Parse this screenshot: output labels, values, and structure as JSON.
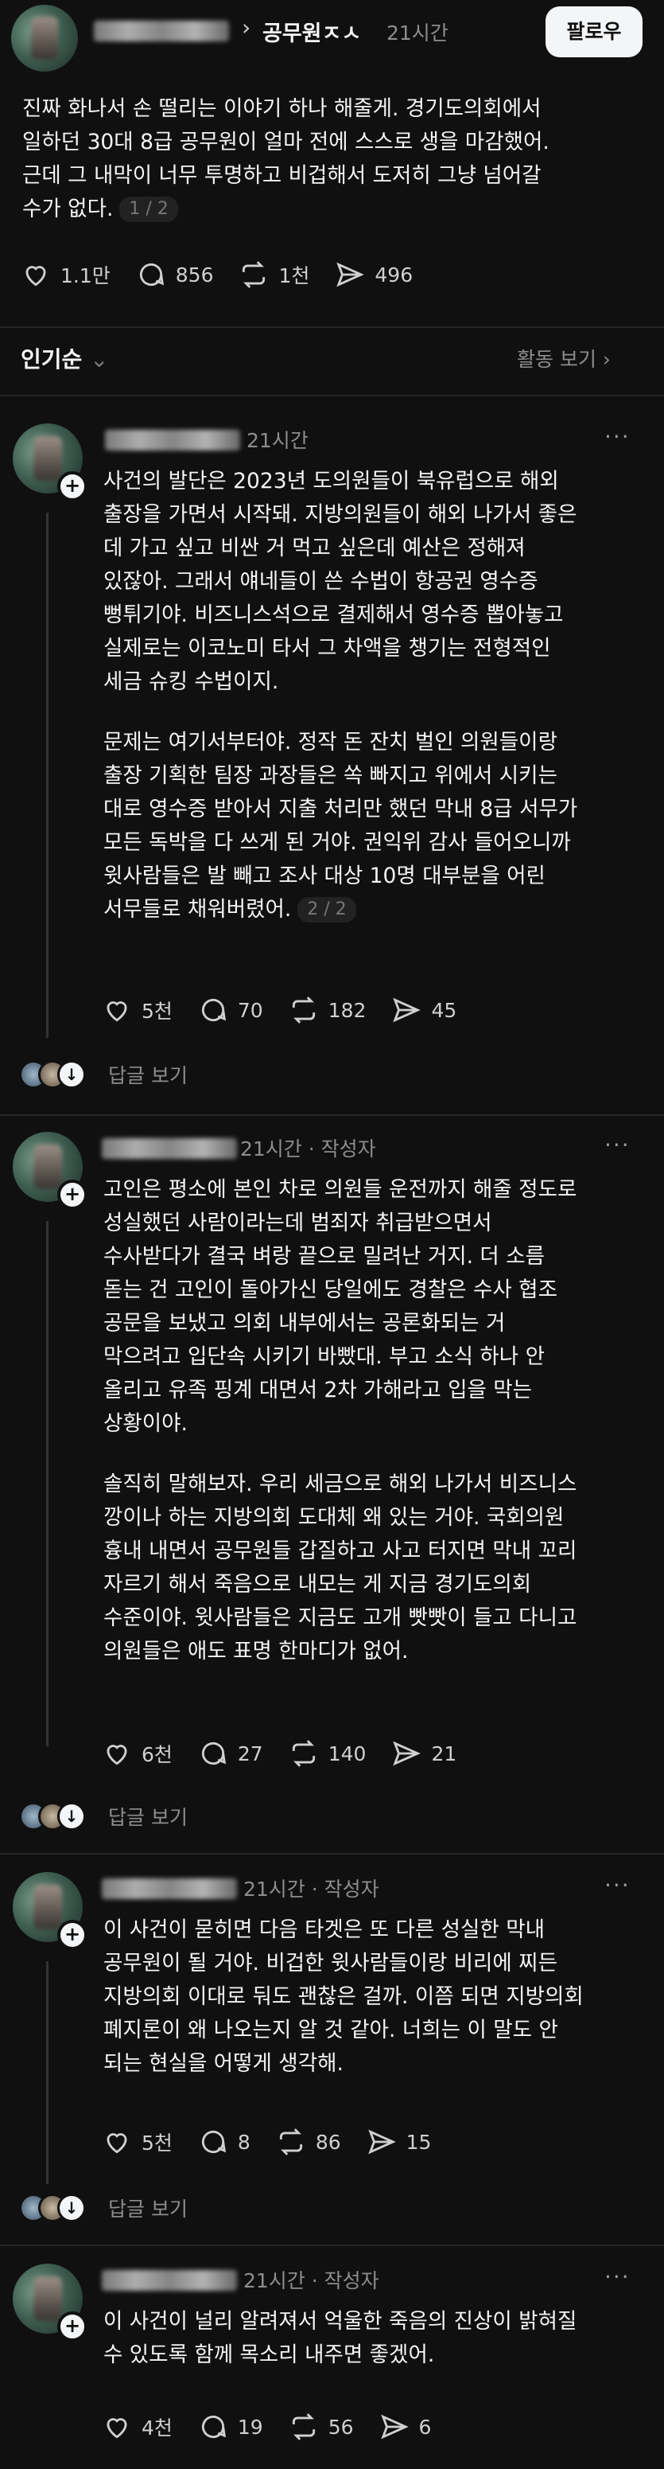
{
  "post": {
    "author_suffix": "공무원ㅈㅅ",
    "time": "21시간",
    "follow_label": "팔로우",
    "text": "진짜 화나서 손 떨리는 이야기 하나 해줄게. 경기도의회에서\n일하던 30대 8급 공무원이 얼마 전에 스스로 생을 마감했어.\n근데 그 내막이 너무 투명하고 비겁해서 도저히 그냥 넘어갈\n수가 없다.",
    "pager": "1 / 2",
    "likes": "1.1만",
    "comments": "856",
    "reposts": "1천",
    "shares": "496"
  },
  "sort": {
    "label": "인기순",
    "activity_label": "활동 보기"
  },
  "replies": [
    {
      "meta": "21시간",
      "paragraph1": "사건의 발단은 2023년 도의원들이 북유럽으로 해외\n출장을 가면서 시작돼. 지방의원들이 해외 나가서 좋은\n데 가고 싶고 비싼 거 먹고 싶은데 예산은 정해져\n있잖아. 그래서 얘네들이 쓴 수법이 항공권 영수증\n뻥튀기야. 비즈니스석으로 결제해서 영수증 뽑아놓고\n실제로는 이코노미 타서 그 차액을 챙기는 전형적인\n세금 슈킹 수법이지.",
      "paragraph2": "문제는 여기서부터야. 정작 돈 잔치 벌인 의원들이랑\n출장 기획한 팀장 과장들은 쏙 빠지고 위에서 시키는\n대로 영수증 받아서 지출 처리만 했던 막내 8급 서무가\n모든 독박을 다 쓰게 된 거야. 권익위 감사 들어오니까\n윗사람들은 발 빼고 조사 대상 10명 대부분을 어린\n서무들로 채워버렸어.",
      "pager": "2 / 2",
      "likes": "5천",
      "comments": "70",
      "reposts": "182",
      "shares": "45",
      "reply_link": "답글 보기"
    },
    {
      "meta": "21시간 · 작성자",
      "paragraph1": "고인은 평소에 본인 차로 의원들 운전까지 해줄 정도로\n성실했던 사람이라는데 범죄자 취급받으면서\n수사받다가 결국 벼랑 끝으로 밀려난 거지. 더 소름\n돋는 건 고인이 돌아가신 당일에도 경찰은 수사 협조\n공문을 보냈고 의회 내부에서는 공론화되는 거\n막으려고 입단속 시키기 바빴대. 부고 소식 하나 안\n올리고 유족 핑계 대면서 2차 가해라고 입을 막는\n상황이야.",
      "paragraph2": "솔직히 말해보자. 우리 세금으로 해외 나가서 비즈니스\n깡이나 하는 지방의회 도대체 왜 있는 거야. 국회의원\n흉내 내면서 공무원들 갑질하고 사고 터지면 막내 꼬리\n자르기 해서 죽음으로 내모는 게 지금 경기도의회\n수준이야. 윗사람들은 지금도 고개 빳빳이 들고 다니고\n의원들은 애도 표명 한마디가 없어.",
      "likes": "6천",
      "comments": "27",
      "reposts": "140",
      "shares": "21",
      "reply_link": "답글 보기"
    },
    {
      "meta": "21시간 · 작성자",
      "paragraph1": "이 사건이 묻히면 다음 타겟은 또 다른 성실한 막내\n공무원이 될 거야. 비겁한 윗사람들이랑 비리에 찌든\n지방의회 이대로 둬도 괜찮은 걸까. 이쯤 되면 지방의회\n폐지론이 왜 나오는지 알 것 같아. 너희는 이 말도 안\n되는 현실을 어떻게 생각해.",
      "likes": "5천",
      "comments": "8",
      "reposts": "86",
      "shares": "15",
      "reply_link": "답글 보기"
    },
    {
      "meta": "21시간 · 작성자",
      "paragraph1": "이 사건이 널리 알려져서 억울한 죽음의 진상이 밝혀질\n수 있도록 함께 목소리 내주면 좋겠어.",
      "likes": "4천",
      "comments": "19",
      "reposts": "56",
      "shares": "6"
    }
  ]
}
